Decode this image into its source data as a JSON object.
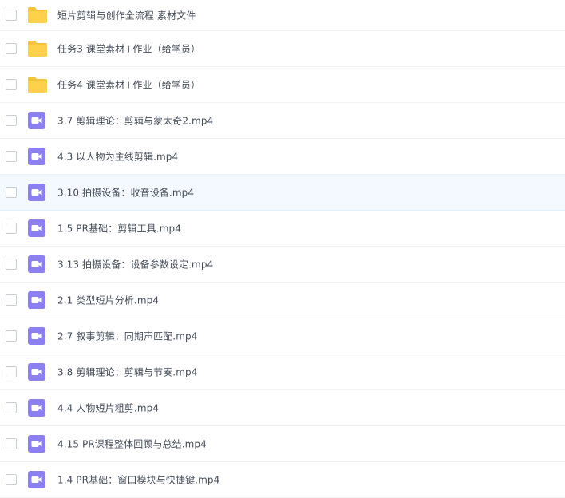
{
  "file_list": {
    "items": [
      {
        "type": "folder",
        "name": "短片剪辑与创作全流程 素材文件",
        "icon": "folder-icon"
      },
      {
        "type": "folder",
        "name": "任务3 课堂素材+作业（给学员）",
        "icon": "folder-icon"
      },
      {
        "type": "folder",
        "name": "任务4 课堂素材+作业（给学员）",
        "icon": "folder-icon"
      },
      {
        "type": "video",
        "name": "3.7 剪辑理论：剪辑与蒙太奇2.mp4",
        "icon": "video-file-icon"
      },
      {
        "type": "video",
        "name": "4.3 以人物为主线剪辑.mp4",
        "icon": "video-file-icon"
      },
      {
        "type": "video",
        "name": "3.10 拍摄设备：收音设备.mp4",
        "icon": "video-file-icon"
      },
      {
        "type": "video",
        "name": "1.5 PR基础：剪辑工具.mp4",
        "icon": "video-file-icon"
      },
      {
        "type": "video",
        "name": "3.13 拍摄设备：设备参数设定.mp4",
        "icon": "video-file-icon"
      },
      {
        "type": "video",
        "name": "2.1 类型短片分析.mp4",
        "icon": "video-file-icon"
      },
      {
        "type": "video",
        "name": "2.7 叙事剪辑：同期声匹配.mp4",
        "icon": "video-file-icon"
      },
      {
        "type": "video",
        "name": "3.8 剪辑理论：剪辑与节奏.mp4",
        "icon": "video-file-icon"
      },
      {
        "type": "video",
        "name": "4.4 人物短片粗剪.mp4",
        "icon": "video-file-icon"
      },
      {
        "type": "video",
        "name": "4.15 PR课程整体回顾与总结.mp4",
        "icon": "video-file-icon"
      },
      {
        "type": "video",
        "name": "1.4 PR基础：窗口模块与快捷键.mp4",
        "icon": "video-file-icon"
      }
    ],
    "hovered_index": 5
  },
  "colors": {
    "folder": "#ffd04c",
    "folder_tab": "#f7c33a",
    "video": "#8c7ff0",
    "row_hover": "#f4f9ff",
    "text": "#454d5a"
  }
}
